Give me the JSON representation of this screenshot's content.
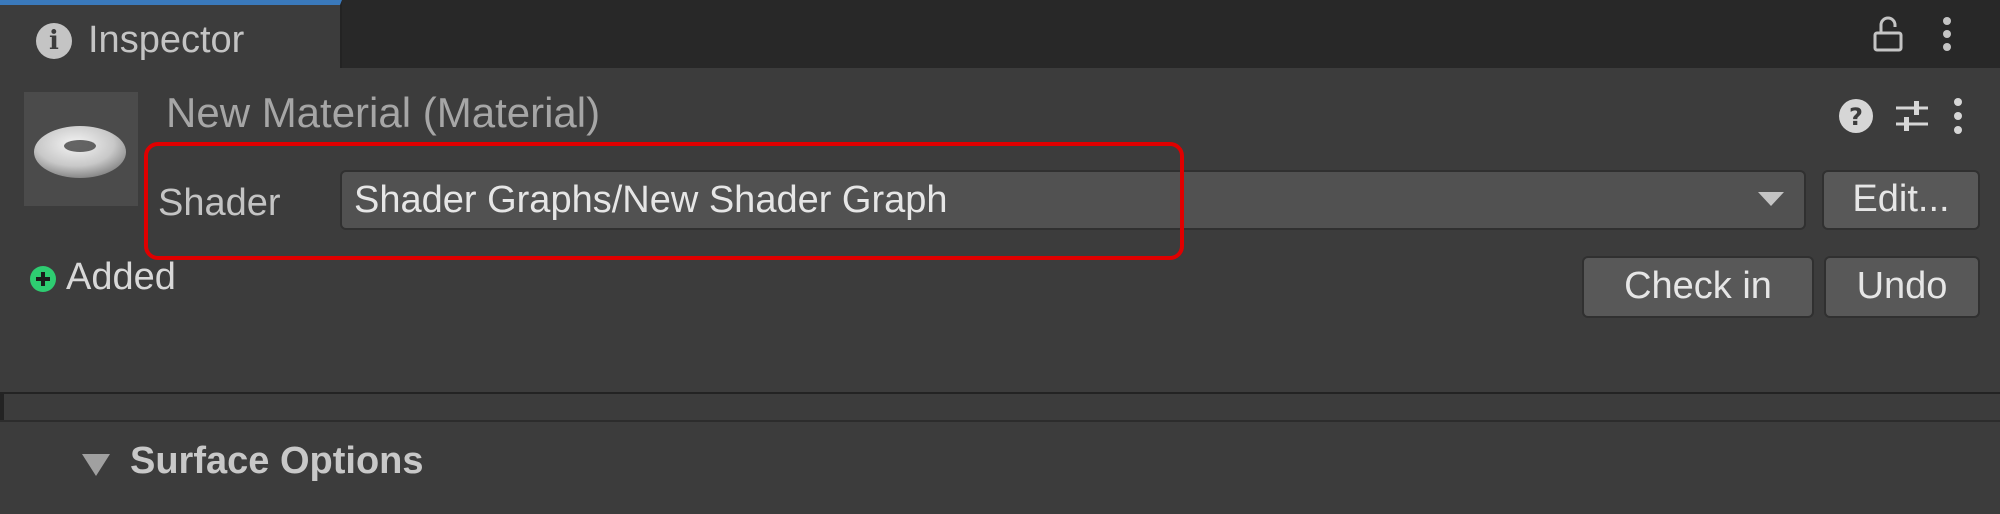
{
  "tab": {
    "title": "Inspector",
    "icon": "info-icon"
  },
  "header": {
    "title": "New Material (Material)",
    "icons": [
      "help-icon",
      "presets-icon",
      "more-icon"
    ]
  },
  "shader": {
    "label": "Shader",
    "value": "Shader Graphs/New Shader Graph",
    "edit_label": "Edit..."
  },
  "status": {
    "icon": "added-icon",
    "color": "#2ecc71",
    "text": "Added"
  },
  "version_control": {
    "check_in_label": "Check in",
    "undo_label": "Undo"
  },
  "section": {
    "title": "Surface Options"
  },
  "colors": {
    "background": "#3c3c3c",
    "tab_accent": "#3a79bb",
    "highlight": "#e00000"
  }
}
